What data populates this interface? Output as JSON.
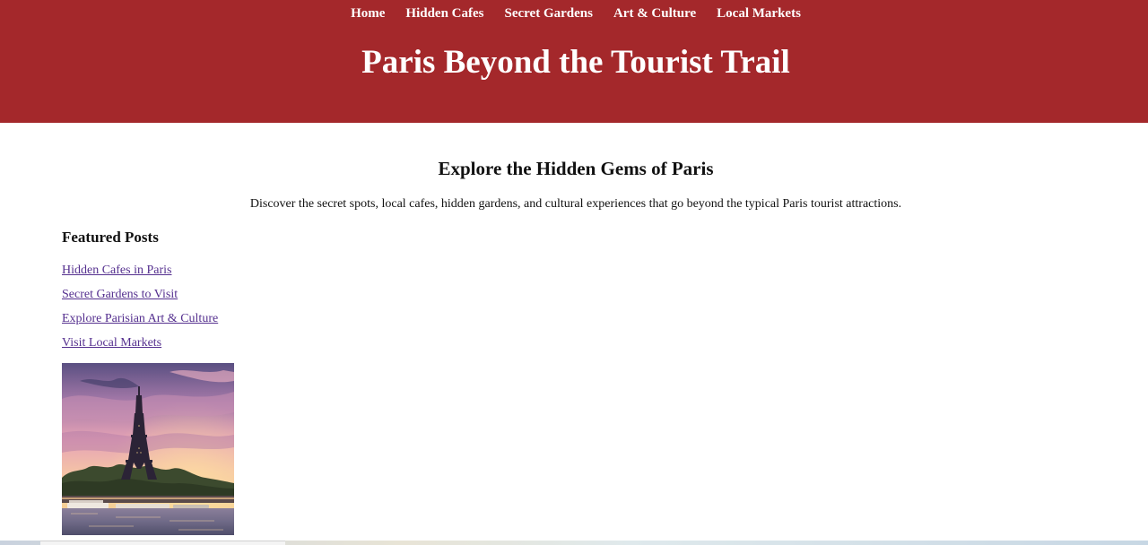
{
  "nav": {
    "items": [
      {
        "label": "Home"
      },
      {
        "label": "Hidden Cafes"
      },
      {
        "label": "Secret Gardens"
      },
      {
        "label": "Art & Culture"
      },
      {
        "label": "Local Markets"
      }
    ]
  },
  "header": {
    "title": "Paris Beyond the Tourist Trail",
    "background_color": "#a4282b"
  },
  "intro": {
    "heading": "Explore the Hidden Gems of Paris",
    "text": "Discover the secret spots, local cafes, hidden gardens, and cultural experiences that go beyond the typical Paris tourist attractions."
  },
  "featured": {
    "heading": "Featured Posts",
    "links": [
      {
        "label": "Hidden Cafes in Paris"
      },
      {
        "label": "Secret Gardens to Visit"
      },
      {
        "label": "Explore Parisian Art & Culture"
      },
      {
        "label": "Visit Local Markets"
      }
    ],
    "link_color": "#55308f"
  },
  "image": {
    "subject": "eiffel-tower-sunset"
  }
}
